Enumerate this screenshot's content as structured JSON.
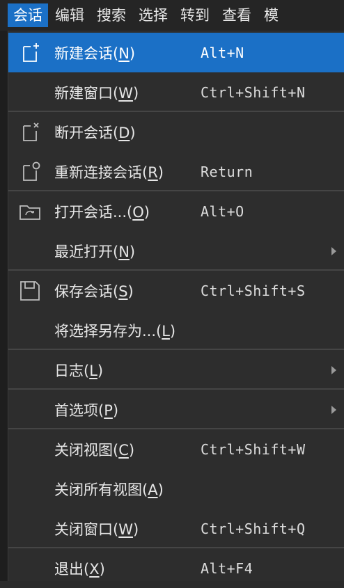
{
  "menubar": {
    "items": [
      "会话",
      "编辑",
      "搜索",
      "选择",
      "转到",
      "查看",
      "模"
    ]
  },
  "menu": {
    "items": [
      {
        "pre": "新建会话(",
        "key": "N",
        "post": ")",
        "shortcut": "Alt+N",
        "icon": "new-session-icon"
      },
      {
        "pre": "新建窗口(",
        "key": "W",
        "post": ")",
        "shortcut": "Ctrl+Shift+N",
        "icon": ""
      },
      {
        "pre": "断开会话(",
        "key": "D",
        "post": ")",
        "shortcut": "",
        "icon": "disconnect-icon"
      },
      {
        "pre": "重新连接会话(",
        "key": "R",
        "post": ")",
        "shortcut": "Return",
        "icon": "reconnect-icon"
      },
      {
        "pre": "打开会话...(",
        "key": "O",
        "post": ")",
        "shortcut": "Alt+O",
        "icon": "open-folder-icon"
      },
      {
        "pre": "最近打开(",
        "key": "N",
        "post": ")",
        "shortcut": "",
        "icon": ""
      },
      {
        "pre": "保存会话(",
        "key": "S",
        "post": ")",
        "shortcut": "Ctrl+Shift+S",
        "icon": "save-icon"
      },
      {
        "pre": "将选择另存为...(",
        "key": "L",
        "post": ")",
        "shortcut": "",
        "icon": ""
      },
      {
        "pre": "日志(",
        "key": "L",
        "post": ")",
        "shortcut": "",
        "icon": ""
      },
      {
        "pre": "首选项(",
        "key": "P",
        "post": ")",
        "shortcut": "",
        "icon": ""
      },
      {
        "pre": "关闭视图(",
        "key": "C",
        "post": ")",
        "shortcut": "Ctrl+Shift+W",
        "icon": ""
      },
      {
        "pre": "关闭所有视图(",
        "key": "A",
        "post": ")",
        "shortcut": "",
        "icon": ""
      },
      {
        "pre": "关闭窗口(",
        "key": "W",
        "post": ")",
        "shortcut": "Ctrl+Shift+Q",
        "icon": ""
      },
      {
        "pre": "退出(",
        "key": "X",
        "post": ")",
        "shortcut": "Alt+F4",
        "icon": ""
      }
    ]
  },
  "colors": {
    "highlight": "#1b70c6",
    "menu_bg": "#2d2d2d",
    "separator": "#454545"
  }
}
